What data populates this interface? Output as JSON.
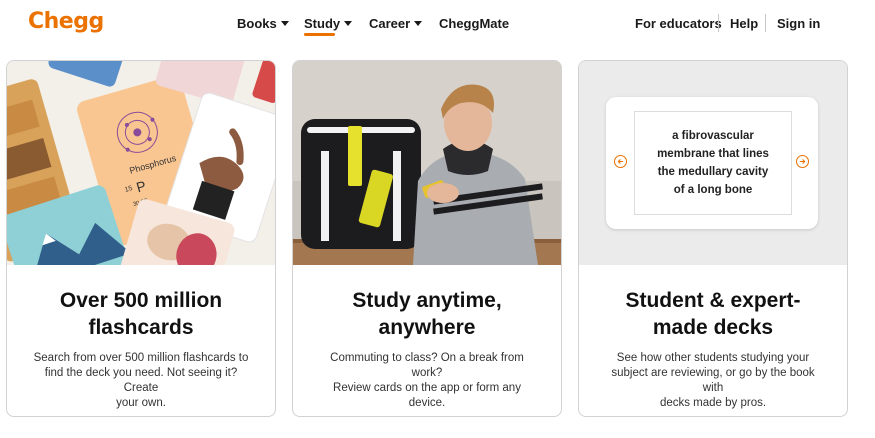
{
  "header": {
    "logo": "Chegg",
    "nav": [
      {
        "label": "Books",
        "dropdown": true
      },
      {
        "label": "Study",
        "dropdown": true,
        "active": true
      },
      {
        "label": "Career",
        "dropdown": true
      },
      {
        "label": "CheggMate",
        "dropdown": false
      }
    ],
    "utility": [
      "For educators",
      "Help",
      "Sign in"
    ]
  },
  "cards": [
    {
      "title_line1": "Over 500 million",
      "title_line2": "flashcards",
      "desc_line1": "Search from over 500 million flashcards to",
      "desc_line2": "find the deck you need. Not seeing it? Create",
      "desc_line3": "your own.",
      "image_caption": {
        "name": "Phosphorus",
        "symbol": "P",
        "number": "15",
        "mass": "30.97"
      }
    },
    {
      "title_line1": "Study anytime,",
      "title_line2": "anywhere",
      "desc_line1": "Commuting to class? On a break from work?",
      "desc_line2": "Review cards on the app or form any device.",
      "desc_line3": ""
    },
    {
      "title_line1": "Student & expert-",
      "title_line2": "made decks",
      "desc_line1": "See how other students studying your",
      "desc_line2": "subject are reviewing, or go by the book with",
      "desc_line3": "decks made by pros.",
      "flashcard_lines": [
        "a fibrovascular",
        "membrane that lines",
        "the medullary cavity",
        "of a long bone"
      ]
    }
  ],
  "colors": {
    "brand_orange": "#eb7100",
    "text_dark": "#1a1a1a",
    "panel_gray": "#ebebeb",
    "card_border": "#d2d2d2"
  },
  "icons": [
    "caret-down-icon",
    "arrow-left-icon",
    "arrow-right-icon"
  ]
}
